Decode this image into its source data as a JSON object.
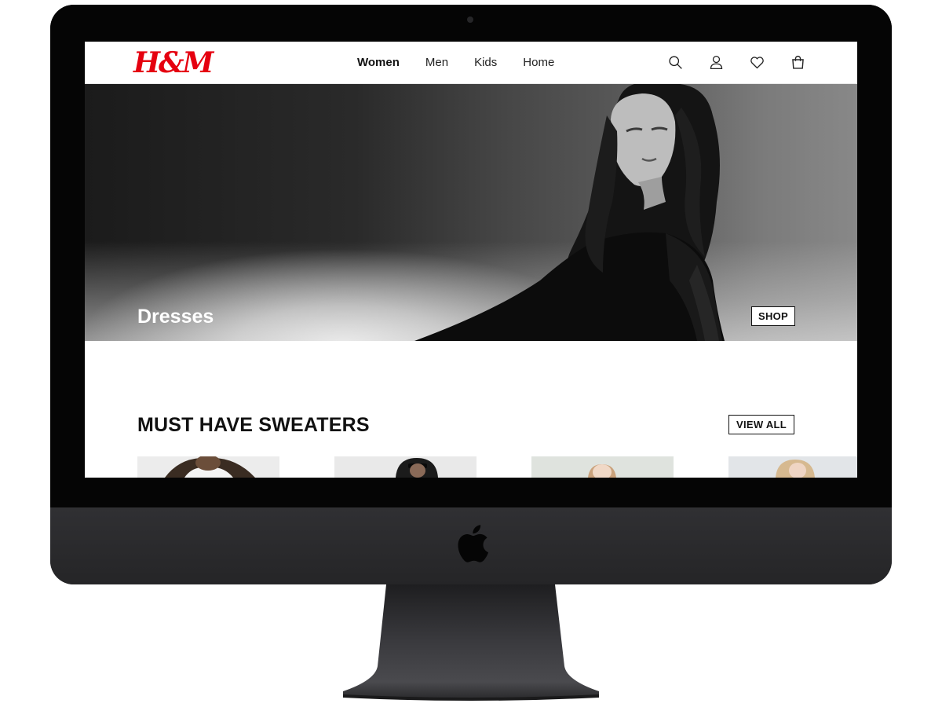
{
  "brand": {
    "logo_text": "H&M",
    "color": "#e50010"
  },
  "nav": {
    "links": [
      {
        "label": "Women",
        "active": true
      },
      {
        "label": "Men",
        "active": false
      },
      {
        "label": "Kids",
        "active": false
      },
      {
        "label": "Home",
        "active": false
      }
    ],
    "icons": [
      "search-icon",
      "account-icon",
      "favorites-icon",
      "shopping-bag-icon"
    ]
  },
  "hero": {
    "title": "Dresses",
    "button_label": "SHOP"
  },
  "section": {
    "title": "MUST HAVE SWEATERS",
    "button_label": "VIEW ALL"
  },
  "products": [
    {
      "image": "model-white-sweater"
    },
    {
      "image": "model-dark-sunglasses"
    },
    {
      "image": "model-light-background"
    },
    {
      "image": "model-blonde"
    }
  ],
  "device": {
    "type": "iMac",
    "logo": "apple-logo"
  }
}
